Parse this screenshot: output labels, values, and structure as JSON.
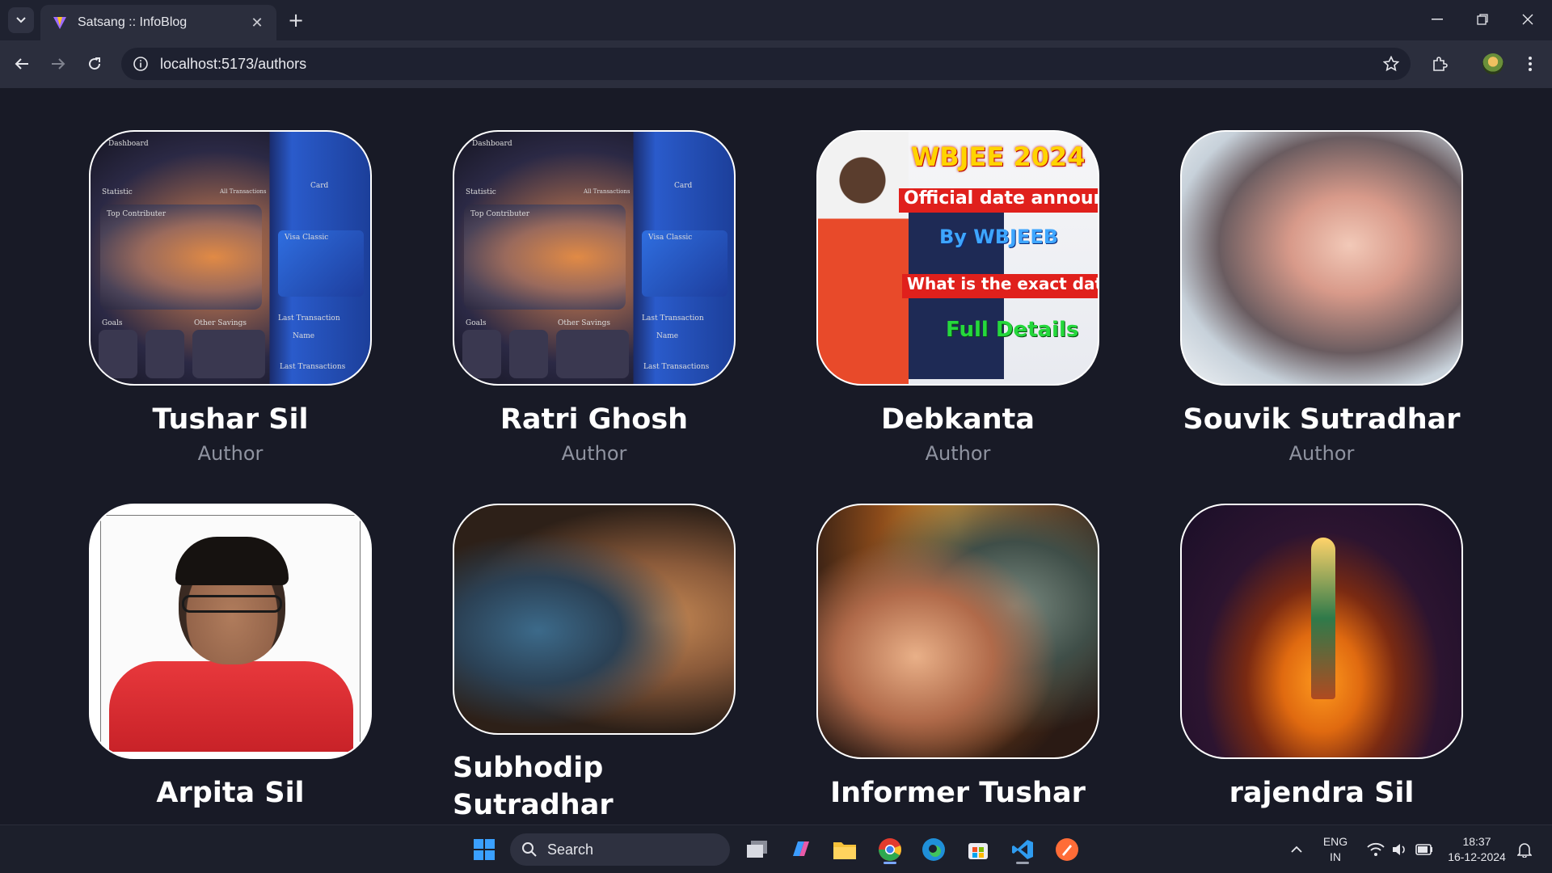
{
  "browser": {
    "tab_title": "Satsang :: InfoBlog",
    "url": "localhost:5173/authors"
  },
  "authors": [
    {
      "name": "Tushar Sil",
      "role": "Author",
      "image": "dashboard-screenshot"
    },
    {
      "name": "Ratri Ghosh",
      "role": "Author",
      "image": "dashboard-screenshot"
    },
    {
      "name": "Debkanta",
      "role": "Author",
      "image": "wbjee-thumbnail"
    },
    {
      "name": "Souvik Sutradhar",
      "role": "Author",
      "image": "bride-portrait"
    },
    {
      "name": "Arpita Sil",
      "role": "",
      "image": "passport-photo"
    },
    {
      "name": "Subhodip Sutradhar",
      "role": "",
      "image": "radha-krishna-art"
    },
    {
      "name": "Informer Tushar",
      "role": "",
      "image": "radha-krishna-art"
    },
    {
      "name": "rajendra Sil",
      "role": "",
      "image": "lotus-deity-art"
    }
  ],
  "wbjee_thumb": {
    "title": "WBJEE 2024",
    "banner1": "Official date announced",
    "blue": "By WBJEEB",
    "banner2": "What is the exact date?",
    "green": "Full Details"
  },
  "dashboard_thumb": {
    "heading": "Dashboard",
    "statistic": "Statistic",
    "all_tx": "All Transactions",
    "top": "Top Contributer",
    "card": "Card",
    "visa": "Visa Classic",
    "goals": "Goals",
    "savings": "Other Savings",
    "last_tx": "Last Transaction",
    "last_txs": "Last Transactions",
    "name": "Name"
  },
  "taskbar": {
    "search_placeholder": "Search",
    "lang_top": "ENG",
    "lang_bottom": "IN",
    "time": "18:37",
    "date": "16-12-2024"
  }
}
